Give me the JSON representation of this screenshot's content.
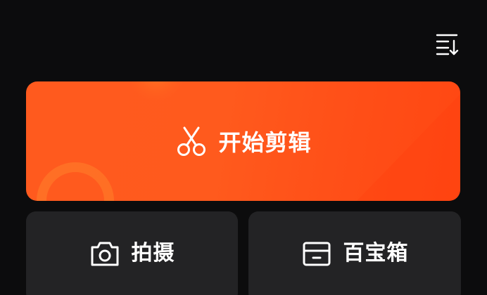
{
  "topbar": {
    "sort_icon": "sort-descending-icon"
  },
  "hero": {
    "label": "开始剪辑",
    "icon": "scissors-icon",
    "accent": "#ff5a1e"
  },
  "actions": [
    {
      "label": "拍摄",
      "icon": "camera-icon"
    },
    {
      "label": "百宝箱",
      "icon": "toolbox-icon"
    }
  ],
  "colors": {
    "background": "#0c0c0d",
    "card": "#232325",
    "text": "#ffffff"
  }
}
